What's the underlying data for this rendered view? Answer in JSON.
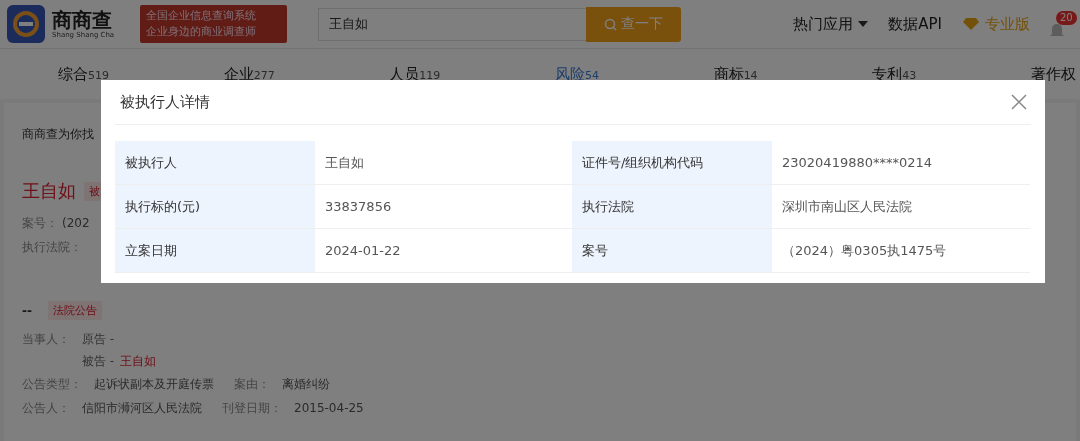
{
  "header": {
    "logo": {
      "name": "商商查",
      "subtitle": "Shang Shang Cha"
    },
    "slogan": [
      "全国企业信息查询系统",
      "企业身边的商业调查师"
    ],
    "search": {
      "value": "王自如"
    },
    "search_button": "查一下",
    "nav": [
      {
        "label": "热门应用",
        "kind": "dropdown"
      },
      {
        "label": "数据API",
        "kind": "link"
      },
      {
        "label": "专业版",
        "kind": "pro"
      }
    ],
    "notification_count": "20"
  },
  "tabs": [
    {
      "label": "综合",
      "count": "519",
      "selected": false
    },
    {
      "label": "企业",
      "count": "277",
      "selected": false
    },
    {
      "label": "人员",
      "count": "119",
      "selected": false
    },
    {
      "label": "风险",
      "count": "54",
      "selected": true
    },
    {
      "label": "商标",
      "count": "14",
      "selected": false
    },
    {
      "label": "专利",
      "count": "43",
      "selected": false
    },
    {
      "label": "著作权",
      "selected": false
    }
  ],
  "intro": "商商查为你找",
  "record": {
    "name": "王自如",
    "tag": "被",
    "fields": [
      {
        "label": "案号：",
        "value": "(202"
      },
      {
        "label": "执行法院："
      }
    ]
  },
  "notice": {
    "title": "--",
    "tag": "法院公告",
    "party_label": "当事人：",
    "parties": [
      {
        "role": "原告 -"
      },
      {
        "role": "被告 -",
        "name": "王自如"
      }
    ],
    "rows": [
      [
        {
          "label": "公告类型：",
          "value": "起诉状副本及开庭传票"
        },
        {
          "label": "案由：",
          "value": "离婚纠纷"
        }
      ],
      [
        {
          "label": "公告人：",
          "value": "信阳市浉河区人民法院"
        },
        {
          "label": "刊登日期：",
          "value": "2015-04-25"
        }
      ]
    ]
  },
  "modal": {
    "title": "被执行人详情",
    "rows": [
      [
        {
          "label": "被执行人",
          "value": "王自如"
        },
        {
          "label": "证件号/组织机构代码",
          "value": "23020419880****0214"
        }
      ],
      [
        {
          "label": "执行标的(元)",
          "value": "33837856"
        },
        {
          "label": "执行法院",
          "value": "深圳市南山区人民法院"
        }
      ],
      [
        {
          "label": "立案日期",
          "value": "2024-01-22"
        },
        {
          "label": "案号",
          "value": "（2024）粤0305执1475号"
        }
      ]
    ]
  }
}
